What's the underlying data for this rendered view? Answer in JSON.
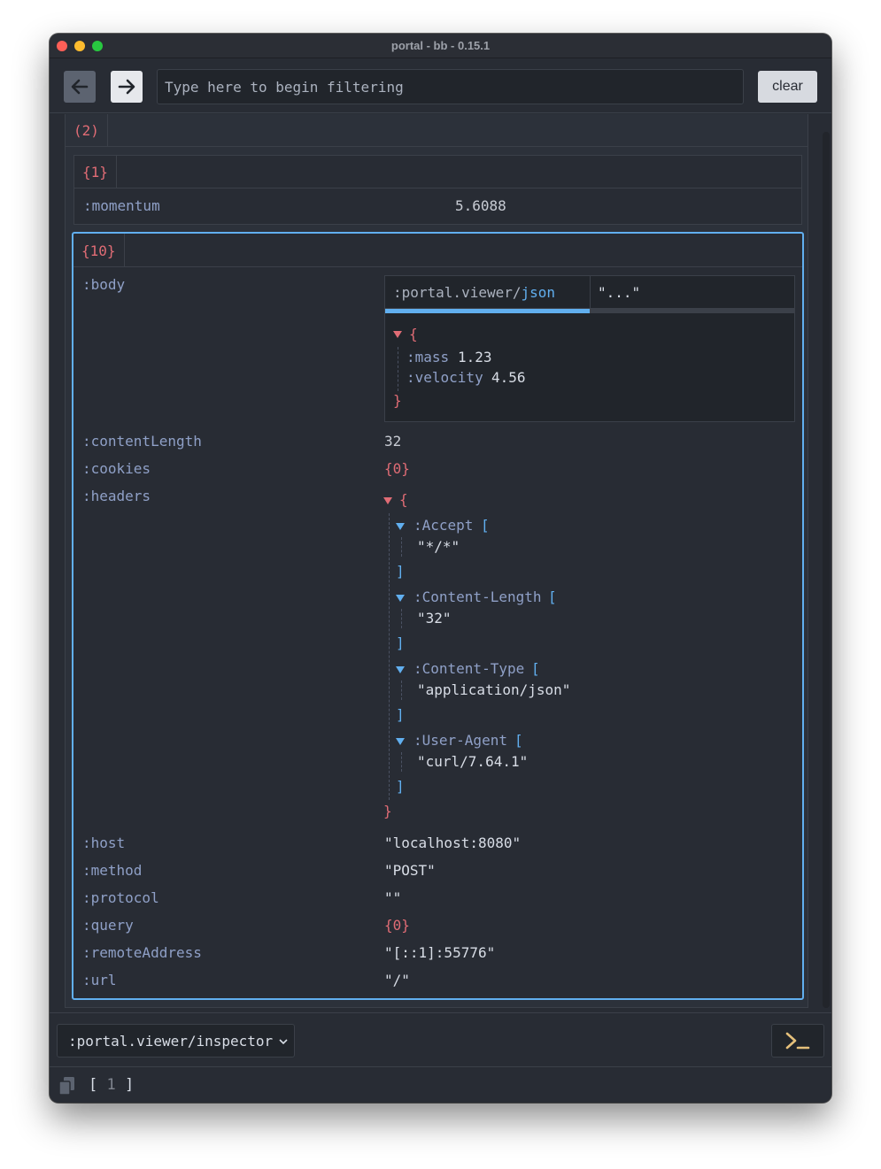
{
  "window": {
    "title": "portal - bb - 0.15.1"
  },
  "toolbar": {
    "filter_placeholder": "Type here to begin filtering",
    "clear_label": "clear"
  },
  "outer": {
    "badge": "(2)"
  },
  "map1": {
    "badge": "{1}",
    "rows": [
      {
        "key": ":momentum",
        "value": "5.6088"
      }
    ]
  },
  "map10": {
    "badge": "{10}",
    "body": {
      "key": ":body",
      "viewer_prefix": ":portal.viewer/",
      "viewer_name": "json",
      "preview": "\"...\"",
      "open_brace": "{",
      "close_brace": "}",
      "fields": [
        {
          "key": ":mass",
          "value": "1.23"
        },
        {
          "key": ":velocity",
          "value": "4.56"
        }
      ]
    },
    "contentLength": {
      "key": ":contentLength",
      "value": "32"
    },
    "cookies": {
      "key": ":cookies",
      "value": "{0}"
    },
    "headers": {
      "key": ":headers",
      "open_brace": "{",
      "close_brace": "}",
      "entries": [
        {
          "key": ":Accept",
          "value": "\"*/*\""
        },
        {
          "key": ":Content-Length",
          "value": "\"32\""
        },
        {
          "key": ":Content-Type",
          "value": "\"application/json\""
        },
        {
          "key": ":User-Agent",
          "value": "\"curl/7.64.1\""
        }
      ]
    },
    "host": {
      "key": ":host",
      "value": "\"localhost:8080\""
    },
    "method": {
      "key": ":method",
      "value": "\"POST\""
    },
    "protocol": {
      "key": ":protocol",
      "value": "\"\""
    },
    "query": {
      "key": ":query",
      "value": "{0}"
    },
    "remoteAddress": {
      "key": ":remoteAddress",
      "value": "\"[::1]:55776\""
    },
    "url": {
      "key": ":url",
      "value": "\"/\""
    }
  },
  "bottombar": {
    "viewer": ":portal.viewer/inspector"
  },
  "statusbar": {
    "selection_open": "[",
    "selection_count": "1",
    "selection_close": "]"
  },
  "icons": {
    "back": "arrow-left-icon",
    "forward": "arrow-right-icon",
    "command": "terminal-prompt-icon",
    "copy": "copy-icon",
    "chevron": "chevron-down-icon",
    "toggle": "triangle-down-icon"
  },
  "colors": {
    "background": "#282c34",
    "key": "#8fa0c7",
    "badge": "#e06c75",
    "accent": "#61afef"
  }
}
